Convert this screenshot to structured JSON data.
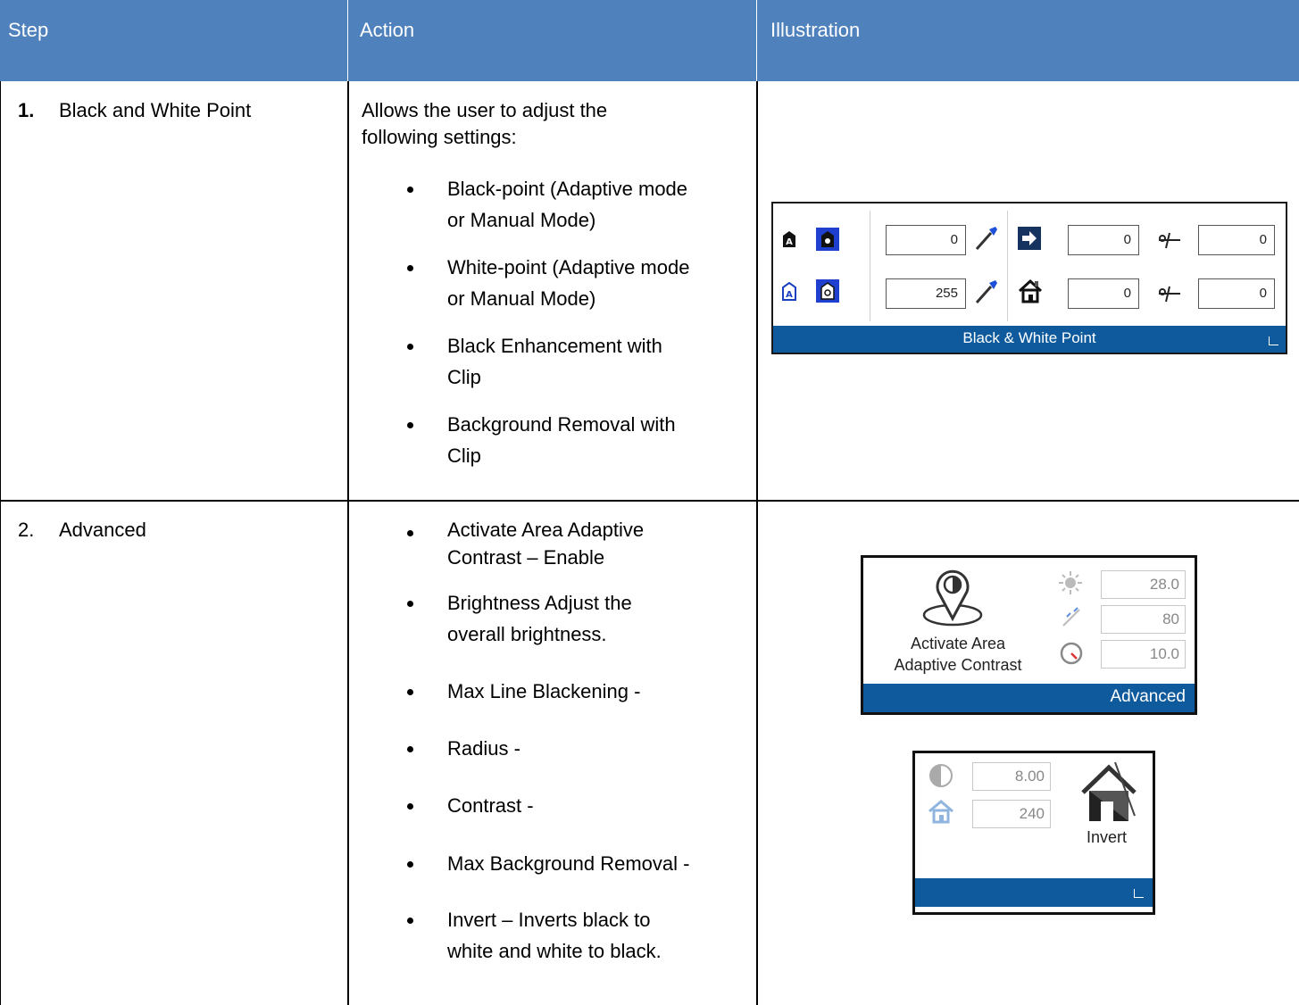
{
  "header": {
    "step": "Step",
    "action": "Action",
    "illustration": "Illustration"
  },
  "rows": [
    {
      "number": "1.",
      "step": "Black and White Point",
      "action_intro": [
        "Allows the user to adjust the",
        "following settings:"
      ],
      "bullets": [
        [
          "Black-point (Adaptive mode",
          "or Manual Mode)"
        ],
        [
          "White-point (Adaptive mode",
          "or Manual Mode)"
        ],
        [
          "Black Enhancement with",
          "Clip"
        ],
        [
          "Background Removal with",
          "Clip"
        ]
      ]
    },
    {
      "number": "2.",
      "step": "Advanced",
      "bullets": [
        [
          "Activate Area Adaptive",
          "Contrast – Enable"
        ],
        [
          "Brightness Adjust the",
          "overall brightness."
        ],
        [
          "Max Line Blackening -"
        ],
        [
          "Radius -"
        ],
        [
          "Contrast -"
        ],
        [
          "Max Background Removal -"
        ],
        [
          "Invert – Inverts black to",
          "white and white to black."
        ]
      ]
    }
  ],
  "panel_bw": {
    "title": "Black & White Point",
    "black_point": "0",
    "white_point": "255",
    "black_enhancement": "0",
    "black_clip": "0",
    "background_removal": "0",
    "background_clip": "0"
  },
  "panel_advanced": {
    "title": "Advanced",
    "button_label_line1": "Activate Area",
    "button_label_line2": "Adaptive Contrast",
    "brightness": "28.0",
    "max_line_blackening": "80",
    "radius": "10.0"
  },
  "panel_invert": {
    "contrast": "8.00",
    "max_background_removal": "240",
    "invert_label": "Invert"
  },
  "colors": {
    "header_bg": "#4f81bd",
    "ribbon_bar": "#0e5a9c"
  }
}
